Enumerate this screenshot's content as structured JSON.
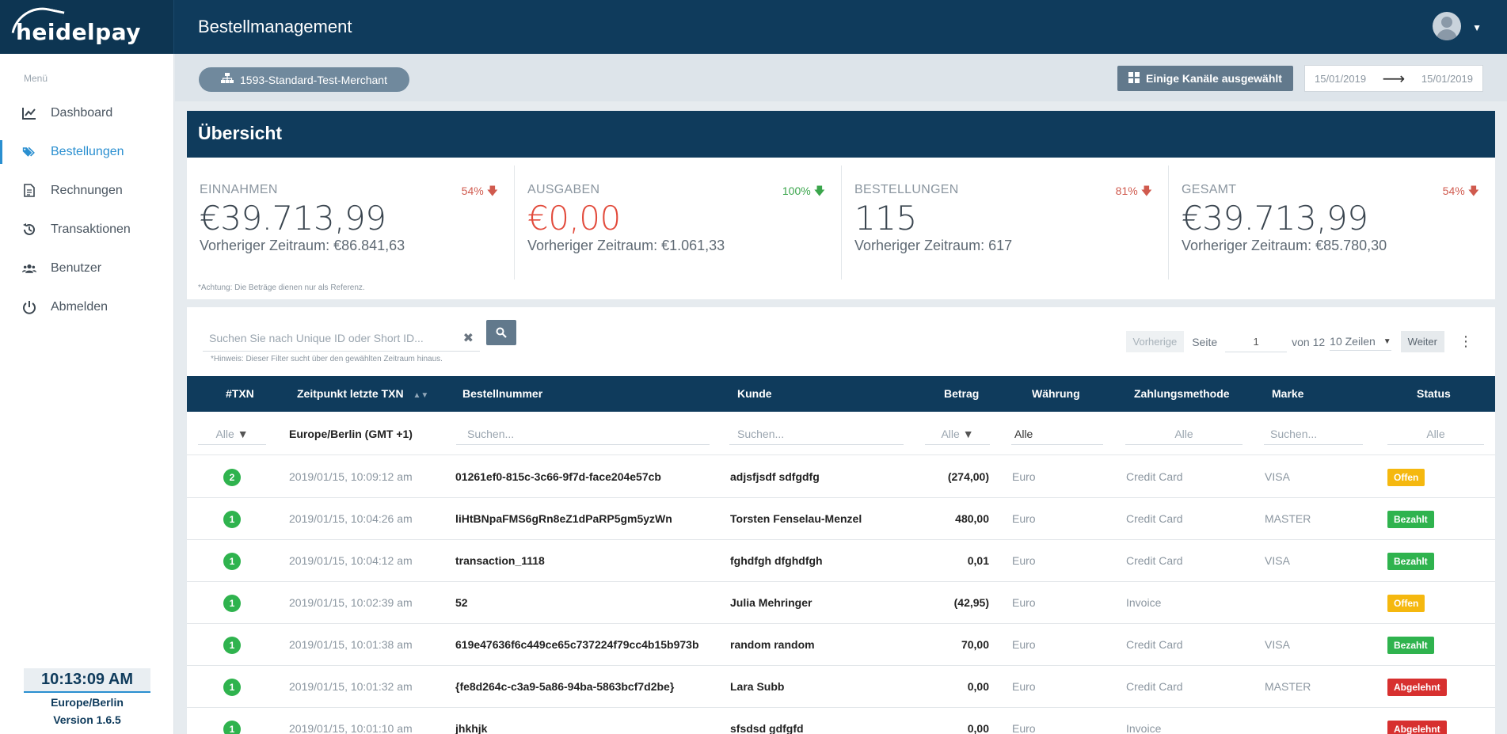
{
  "header": {
    "logo": "heidelpay",
    "title": "Bestellmanagement"
  },
  "sidebar": {
    "menu_label": "Menü",
    "items": [
      {
        "label": "Dashboard",
        "icon": "chart-line-icon"
      },
      {
        "label": "Bestellungen",
        "icon": "tags-icon"
      },
      {
        "label": "Rechnungen",
        "icon": "document-icon"
      },
      {
        "label": "Transaktionen",
        "icon": "history-icon"
      },
      {
        "label": "Benutzer",
        "icon": "users-icon"
      },
      {
        "label": "Abmelden",
        "icon": "power-icon"
      }
    ],
    "active_index": 1,
    "clock_time": "10:13:09 AM",
    "clock_timezone": "Europe/Berlin",
    "version": "Version 1.6.5"
  },
  "subbar": {
    "merchant": "1593-Standard-Test-Merchant",
    "channels": "Einige Kanäle ausgewählt",
    "date_from": "15/01/2019",
    "date_to": "15/01/2019"
  },
  "overview": {
    "title": "Übersicht",
    "kpis": [
      {
        "label": "EINNAHMEN",
        "pct": "54%",
        "value": "€39.713,99",
        "prev": "Vorheriger Zeitraum: €86.841,63"
      },
      {
        "label": "AUSGABEN",
        "pct": "100%",
        "value": "€0,00",
        "prev": "Vorheriger Zeitraum: €1.061,33"
      },
      {
        "label": "BESTELLUNGEN",
        "pct": "81%",
        "value": "115",
        "prev": "Vorheriger Zeitraum: 617"
      },
      {
        "label": "GESAMT",
        "pct": "54%",
        "value": "€39.713,99",
        "prev": "Vorheriger Zeitraum: €85.780,30"
      }
    ],
    "note": "*Achtung: Die Beträge dienen nur als Referenz.",
    "colors": {
      "down": "#d05a4e",
      "green": "#3aa54b",
      "negative_value": "#e24a3b"
    }
  },
  "search": {
    "placeholder": "Suchen Sie nach Unique ID oder Short ID...",
    "hint": "*Hinweis: Dieser Filter sucht über den gewählten Zeitraum hinaus."
  },
  "pager": {
    "prev": "Vorherige",
    "page_label": "Seite",
    "page": "1",
    "of": "von 12",
    "rows": "10 Zeilen",
    "next": "Weiter"
  },
  "table": {
    "columns": [
      "#TXN",
      "Zeitpunkt letzte TXN",
      "Bestellnummer",
      "Kunde",
      "Betrag",
      "Währung",
      "Zahlungsmethode",
      "Marke",
      "Status"
    ],
    "filters": {
      "txn": "Alle",
      "timezone": "Europe/Berlin (GMT +1)",
      "order": "Suchen...",
      "customer": "Suchen...",
      "amount": "Alle",
      "currency": "Alle",
      "method": "Alle",
      "brand": "Suchen...",
      "status": "Alle"
    },
    "rows": [
      {
        "txn": "2",
        "time": "2019/01/15, 10:09:12 am",
        "order": "01261ef0-815c-3c66-9f7d-face204e57cb",
        "customer": "adjsfjsdf sdfgdfg",
        "amount": "(274,00)",
        "currency": "Euro",
        "method": "Credit Card",
        "brand": "VISA",
        "status": "Offen",
        "status_type": "offen"
      },
      {
        "txn": "1",
        "time": "2019/01/15, 10:04:26 am",
        "order": "liHtBNpaFMS6gRn8eZ1dPaRP5gm5yzWn",
        "customer": "Torsten Fenselau-Menzel",
        "amount": "480,00",
        "currency": "Euro",
        "method": "Credit Card",
        "brand": "MASTER",
        "status": "Bezahlt",
        "status_type": "bezahlt"
      },
      {
        "txn": "1",
        "time": "2019/01/15, 10:04:12 am",
        "order": "transaction_1118",
        "customer": "fghdfgh dfghdfgh",
        "amount": "0,01",
        "currency": "Euro",
        "method": "Credit Card",
        "brand": "VISA",
        "status": "Bezahlt",
        "status_type": "bezahlt"
      },
      {
        "txn": "1",
        "time": "2019/01/15, 10:02:39 am",
        "order": "52",
        "customer": "Julia Mehringer",
        "amount": "(42,95)",
        "currency": "Euro",
        "method": "Invoice",
        "brand": "",
        "status": "Offen",
        "status_type": "offen"
      },
      {
        "txn": "1",
        "time": "2019/01/15, 10:01:38 am",
        "order": "619e47636f6c449ce65c737224f79cc4b15b973b",
        "customer": "random random",
        "amount": "70,00",
        "currency": "Euro",
        "method": "Credit Card",
        "brand": "VISA",
        "status": "Bezahlt",
        "status_type": "bezahlt"
      },
      {
        "txn": "1",
        "time": "2019/01/15, 10:01:32 am",
        "order": "{fe8d264c-c3a9-5a86-94ba-5863bcf7d2be}",
        "customer": "Lara Subb",
        "amount": "0,00",
        "currency": "Euro",
        "method": "Credit Card",
        "brand": "MASTER",
        "status": "Abgelehnt",
        "status_type": "abgelehnt"
      },
      {
        "txn": "1",
        "time": "2019/01/15, 10:01:10 am",
        "order": "jhkhjk",
        "customer": "sfsdsd gdfgfd",
        "amount": "0,00",
        "currency": "Euro",
        "method": "Invoice",
        "brand": "",
        "status": "Abgelehnt",
        "status_type": "abgelehnt"
      }
    ]
  }
}
